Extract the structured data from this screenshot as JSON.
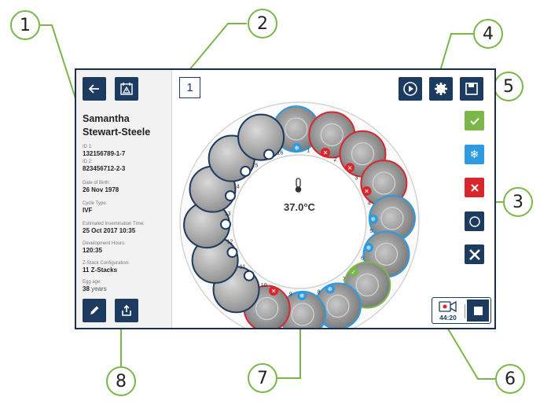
{
  "callouts": [
    "1",
    "2",
    "3",
    "4",
    "5",
    "6",
    "7",
    "8"
  ],
  "sidebar": {
    "patient_name": "Samantha Stewart-Steele",
    "fields": [
      {
        "label": "ID 1:",
        "value": "132156789-1-7"
      },
      {
        "label": "ID 2:",
        "value": "823456712-2-3"
      },
      {
        "label": "Date of Birth:",
        "value": "26 Nov 1978"
      },
      {
        "label": "Cycle Type:",
        "value": "IVF"
      },
      {
        "label": "Estimated Insemination Time:",
        "value": "25 Oct 2017 10:35"
      },
      {
        "label": "Development Hours:",
        "value": "120:35"
      },
      {
        "label": "Z-Stack Configuration:",
        "value": "11 Z-Stacks"
      },
      {
        "label": "Egg age:",
        "value": "38",
        "unit": "years"
      }
    ]
  },
  "main": {
    "slot_number": "1",
    "temperature": "37.0°C"
  },
  "recording": {
    "time": "44:20"
  },
  "wells": [
    {
      "n": "1",
      "status": "frozen"
    },
    {
      "n": "2",
      "status": "discard"
    },
    {
      "n": "3",
      "status": "discard"
    },
    {
      "n": "4",
      "status": "discard"
    },
    {
      "n": "5",
      "status": "frozen"
    },
    {
      "n": "6",
      "status": "frozen"
    },
    {
      "n": "7",
      "status": "transfer"
    },
    {
      "n": "8",
      "status": "frozen"
    },
    {
      "n": "9",
      "status": "frozen"
    },
    {
      "n": "10",
      "status": "discard"
    },
    {
      "n": "11",
      "status": "empty"
    },
    {
      "n": "12",
      "status": "empty"
    },
    {
      "n": "13",
      "status": "empty"
    },
    {
      "n": "14",
      "status": "empty"
    },
    {
      "n": "15",
      "status": "empty"
    },
    {
      "n": "16",
      "status": "empty"
    }
  ],
  "colors": {
    "navy": "#1d3a5f",
    "frozen": "#2e9be0",
    "discard": "#d8262c",
    "transfer": "#7ab648",
    "empty": "#1d3a5f",
    "callout": "#7ab648"
  }
}
